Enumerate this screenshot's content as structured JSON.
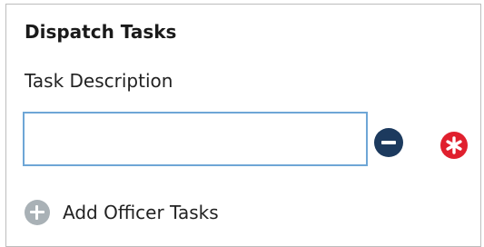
{
  "section": {
    "title": "Dispatch Tasks"
  },
  "task_field": {
    "label": "Task Description",
    "value": ""
  },
  "actions": {
    "add_label": "Add Officer Tasks"
  },
  "icons": {
    "remove": "minus-circle-icon",
    "required": "asterisk-circle-icon",
    "add": "plus-circle-icon"
  },
  "colors": {
    "remove_button": "#1c3a5e",
    "required_icon": "#e0202e",
    "add_icon": "#a9b1b6",
    "input_border": "#6ea6d6"
  }
}
